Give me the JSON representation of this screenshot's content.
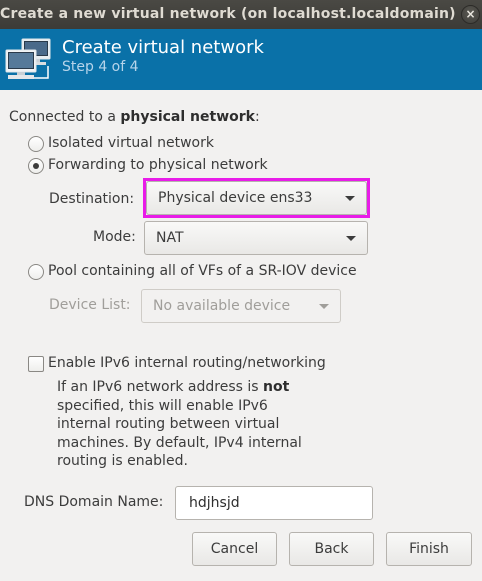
{
  "window": {
    "title": "Create a new virtual network (on localhost.localdomain)",
    "close_glyph": "×"
  },
  "banner": {
    "icon": "network-computers-icon",
    "title": "Create virtual network",
    "subtitle": "Step 4 of 4"
  },
  "form": {
    "heading_prefix": "Connected to a ",
    "heading_bold": "physical network",
    "heading_suffix": ":",
    "options": {
      "isolated": {
        "label": "Isolated virtual network",
        "checked": false
      },
      "forwarding": {
        "label": "Forwarding to physical network",
        "checked": true
      },
      "sriov": {
        "label": "Pool containing all of VFs of a SR-IOV device",
        "checked": false
      }
    },
    "destination": {
      "label": "Destination:",
      "value": "Physical device ens33"
    },
    "mode": {
      "label": "Mode:",
      "value": "NAT"
    },
    "device_list": {
      "label": "Device List:",
      "value": "No available device"
    },
    "ipv6": {
      "label": "Enable IPv6 internal routing/networking",
      "checked": false,
      "desc_part1": "If an IPv6 network address is ",
      "desc_bold": "not",
      "desc_part2": " specified, this will enable IPv6 internal routing between virtual machines.  By default, IPv4 internal routing is enabled."
    },
    "dns": {
      "label": "DNS Domain Name:",
      "value": "hdjhsjd"
    }
  },
  "buttons": {
    "cancel": "Cancel",
    "back": "Back",
    "finish": "Finish"
  },
  "colors": {
    "banner": "#0a71a8",
    "highlight": "#e81ce8",
    "titlebar": "#3c3b37"
  }
}
